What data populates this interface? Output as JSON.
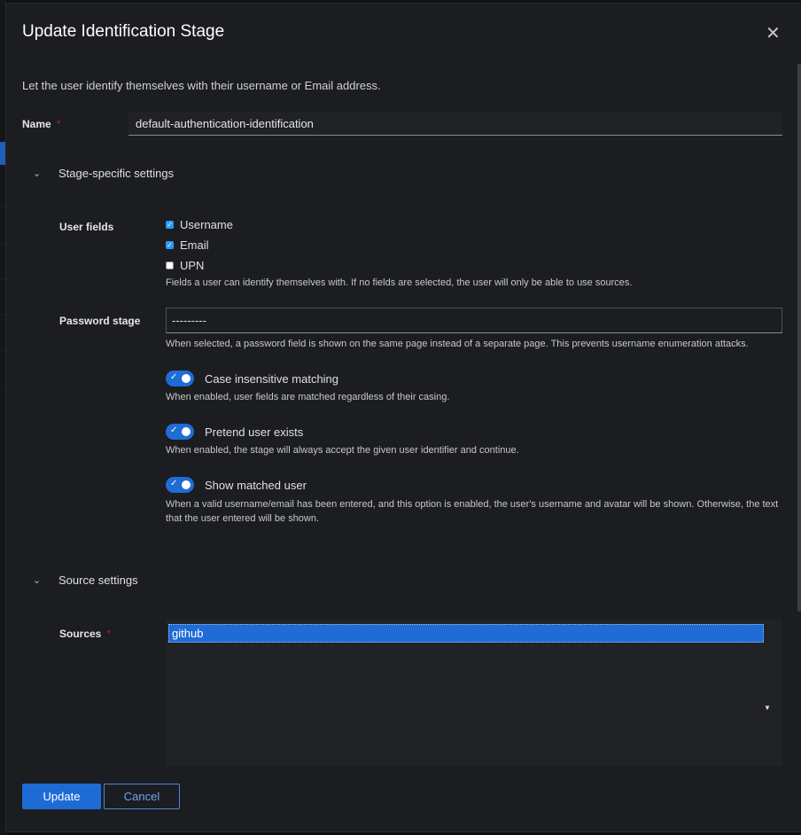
{
  "modal": {
    "title": "Update Identification Stage",
    "close_icon": "close-icon",
    "description": "Let the user identify themselves with their username or Email address."
  },
  "name_field": {
    "label": "Name",
    "required_mark": "*",
    "value": "default-authentication-identification"
  },
  "stage_settings": {
    "header": "Stage-specific settings",
    "user_fields": {
      "label": "User fields",
      "options": [
        {
          "label": "Username",
          "checked": true
        },
        {
          "label": "Email",
          "checked": true
        },
        {
          "label": "UPN",
          "checked": false
        }
      ],
      "help": "Fields a user can identify themselves with. If no fields are selected, the user will only be able to use sources."
    },
    "password_stage": {
      "label": "Password stage",
      "value": "---------",
      "help": "When selected, a password field is shown on the same page instead of a separate page. This prevents username enumeration attacks."
    },
    "switches": [
      {
        "label": "Case insensitive matching",
        "on": true,
        "help": "When enabled, user fields are matched regardless of their casing."
      },
      {
        "label": "Pretend user exists",
        "on": true,
        "help": "When enabled, the stage will always accept the given user identifier and continue."
      },
      {
        "label": "Show matched user",
        "on": true,
        "help": "When a valid username/email has been entered, and this option is enabled, the user's username and avatar will be shown. Otherwise, the text that the user entered will be shown."
      }
    ]
  },
  "source_settings": {
    "header": "Source settings",
    "sources": {
      "label": "Sources",
      "required_mark": "*",
      "selected": [
        "github"
      ]
    }
  },
  "actions": {
    "update_label": "Update",
    "cancel_label": "Cancel"
  },
  "colors": {
    "accent": "#1e6bd6",
    "background": "#1b1d21",
    "required": "#c9190b"
  }
}
